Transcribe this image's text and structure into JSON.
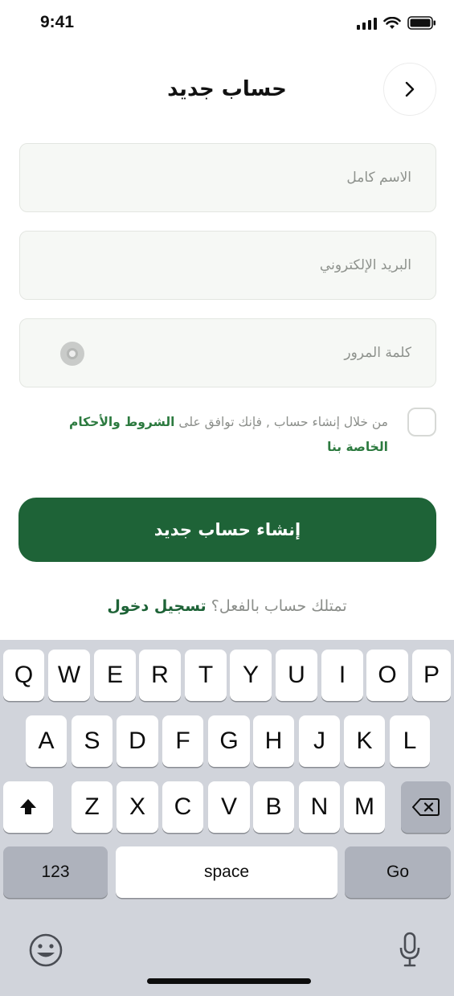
{
  "status_bar": {
    "time": "9:41"
  },
  "header": {
    "title": "حساب جديد"
  },
  "form": {
    "full_name": {
      "placeholder": "الاسم كامل",
      "value": ""
    },
    "email": {
      "placeholder": "البريد الإلكتروني",
      "value": ""
    },
    "password": {
      "placeholder": "كلمة المرور",
      "value": ""
    }
  },
  "terms": {
    "text": "من خلال إنشاء حساب , فإنك توافق على",
    "link": "الشروط والأحكام الخاصة بنا"
  },
  "submit_label": "إنشاء حساب جديد",
  "login_prompt": {
    "text": "تمتلك حساب بالفعل؟",
    "link": "تسجيل دخول"
  },
  "keyboard": {
    "row1": [
      "Q",
      "W",
      "E",
      "R",
      "T",
      "Y",
      "U",
      "I",
      "O",
      "P"
    ],
    "row2": [
      "A",
      "S",
      "D",
      "F",
      "G",
      "H",
      "J",
      "K",
      "L"
    ],
    "row3": [
      "Z",
      "X",
      "C",
      "V",
      "B",
      "N",
      "M"
    ],
    "numbers_label": "123",
    "space_label": "space",
    "go_label": "Go"
  },
  "colors": {
    "primary": "#1e6337",
    "link": "#2c7a3f",
    "field_bg": "#f6f8f5",
    "keyboard_bg": "#d1d4db"
  },
  "icons": [
    "chevron-right-icon",
    "eye-icon",
    "shift-icon",
    "backspace-icon",
    "emoji-icon",
    "microphone-icon"
  ]
}
